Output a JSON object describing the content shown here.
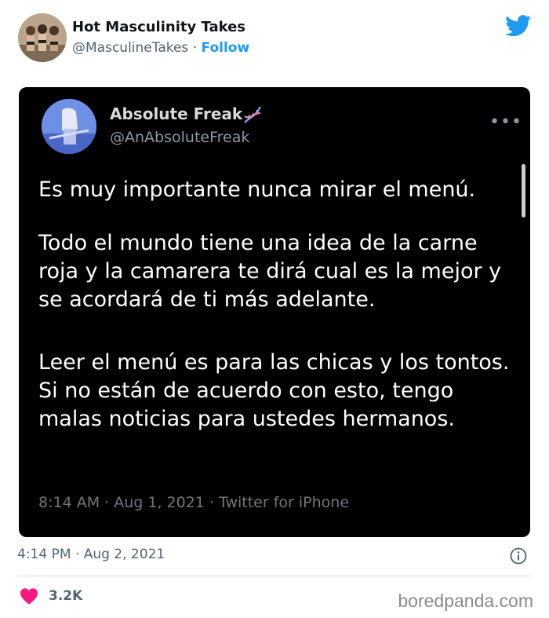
{
  "outer_tweet": {
    "display_name": "Hot Masculinity Takes",
    "handle": "@MasculineTakes",
    "separator": " · ",
    "follow_label": "Follow",
    "timestamp": "4:14 PM · Aug 2, 2021",
    "likes": "3.2K",
    "icons": {
      "brand": "twitter-bird-icon",
      "info": "info-icon",
      "like": "heart-icon"
    },
    "colors": {
      "accent": "#1d9bf0",
      "heart": "#f91880"
    }
  },
  "embedded_tweet": {
    "display_name": "Absolute Freak",
    "handle": "@AnAbsoluteFreak",
    "paragraphs": [
      "Es muy importante nunca mirar el menú.",
      "Todo el mundo tiene una idea de la carne roja y la camarera te dirá cual es la mejor y se acordará de ti más adelante.",
      "Leer el menú es para las chicas y los tontos. Si no están de acuerdo con esto, tengo malas noticias para ustedes hermanos."
    ],
    "meta": "8:14 AM · Aug 1, 2021 · Twitter for iPhone",
    "icons": {
      "emoji": "dna-icon",
      "more": "more-icon"
    }
  },
  "watermark": "boredpanda.com"
}
